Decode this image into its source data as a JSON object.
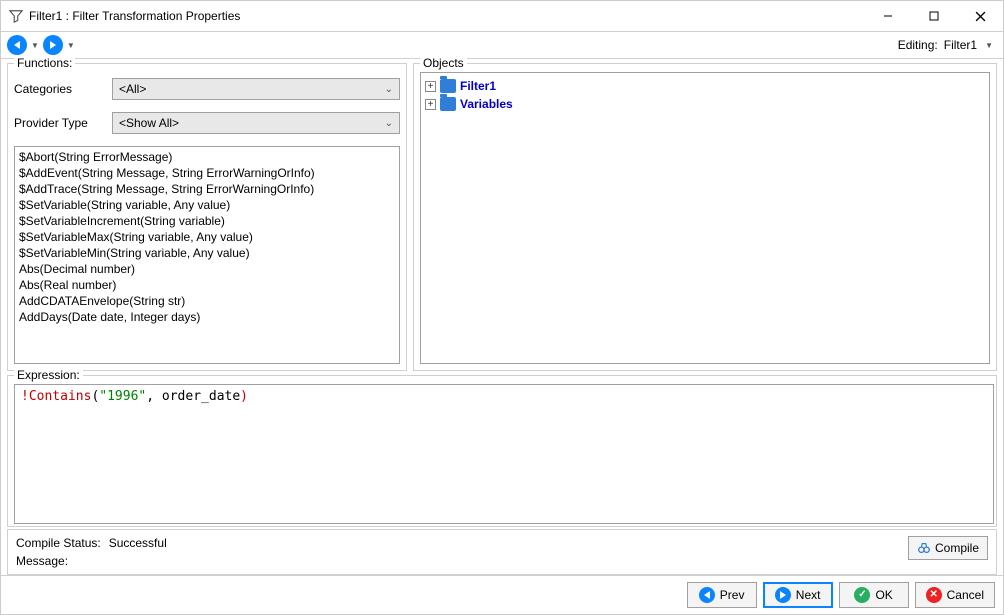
{
  "window": {
    "title": "Filter1 : Filter Transformation Properties"
  },
  "toolbar": {
    "editing_label": "Editing:",
    "editing_value": "Filter1"
  },
  "functions": {
    "group_label": "Functions:",
    "categories_label": "Categories",
    "categories_value": "<All>",
    "provider_label": "Provider Type",
    "provider_value": "<Show All>",
    "list": [
      "$Abort(String ErrorMessage)",
      "$AddEvent(String Message, String ErrorWarningOrInfo)",
      "$AddTrace(String Message, String ErrorWarningOrInfo)",
      "$SetVariable(String variable, Any value)",
      "$SetVariableIncrement(String variable)",
      "$SetVariableMax(String variable, Any value)",
      "$SetVariableMin(String variable, Any value)",
      "Abs(Decimal number)",
      "Abs(Real number)",
      "AddCDATAEnvelope(String str)",
      "AddDays(Date date, Integer days)"
    ]
  },
  "objects": {
    "group_label": "Objects",
    "items": [
      {
        "label": "Filter1"
      },
      {
        "label": "Variables"
      }
    ]
  },
  "expression": {
    "group_label": "Expression:",
    "tokens": {
      "t1": "!Contains",
      "t2": "(",
      "t3": "\"1996\"",
      "t4": ", order_date",
      "t5": ")"
    }
  },
  "status": {
    "compile_label": "Compile Status:",
    "compile_value": "Successful",
    "message_label": "Message:",
    "message_value": "",
    "compile_btn": "Compile"
  },
  "footer": {
    "prev": "Prev",
    "next": "Next",
    "ok": "OK",
    "cancel": "Cancel"
  }
}
